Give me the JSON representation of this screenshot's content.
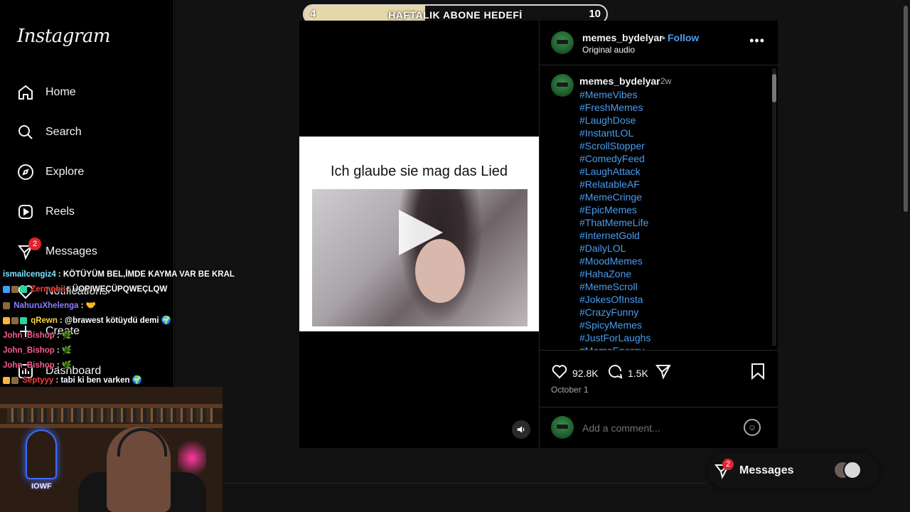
{
  "app": {
    "logo": "Instagram"
  },
  "sidebar": {
    "items": [
      {
        "label": "Home",
        "icon": "home-icon"
      },
      {
        "label": "Search",
        "icon": "search-icon"
      },
      {
        "label": "Explore",
        "icon": "compass-icon"
      },
      {
        "label": "Reels",
        "icon": "reels-icon"
      },
      {
        "label": "Messages",
        "icon": "messages-icon",
        "badge": "2"
      },
      {
        "label": "Notifications",
        "icon": "heart-icon"
      },
      {
        "label": "Create",
        "icon": "plus-icon"
      },
      {
        "label": "Dashboard",
        "icon": "dashboard-icon"
      }
    ]
  },
  "goal": {
    "left": "4",
    "title": "HAFTALIK ABONE HEDEFİ",
    "right": "10",
    "fill_fraction": 0.4,
    "fill_color": "#e5d7aa"
  },
  "post": {
    "media": {
      "caption": "Ich glaube sie mag das Lied"
    },
    "header": {
      "username": "memes_bydelyar",
      "dot": "•",
      "follow": "Follow",
      "audio": "Original audio",
      "more": "•••"
    },
    "caption": {
      "username": "memes_bydelyar",
      "time": "2w",
      "tags": [
        "#MemeVibes",
        "#FreshMemes",
        "#LaughDose",
        "#InstantLOL",
        "#ScrollStopper",
        "#ComedyFeed",
        "#LaughAttack",
        "#RelatableAF",
        "#MemeCringe",
        "#EpicMemes",
        "#ThatMemeLife",
        "#InternetGold",
        "#DailyLOL",
        "#MoodMemes",
        "#HahaZone",
        "#MemeScroll",
        "#JokesOfInsta",
        "#CrazyFunny",
        "#SpicyMemes",
        "#JustForLaughs",
        "#MemeEnergy"
      ]
    },
    "actions": {
      "likes": "92.8K",
      "comments": "1.5K"
    },
    "date": "October 1",
    "comment": {
      "placeholder": "Add a comment..."
    }
  },
  "messages_pill": {
    "label": "Messages",
    "badge": "2"
  },
  "chat": [
    {
      "user": "ismailcengiz4",
      "user_color": "#7fe3ff",
      "text": ": KÖTÜYÜM BEL,İMDE KAYMA VAR BE KRAL"
    },
    {
      "user": "Zermobii",
      "user_color": "#ff3a3a",
      "text": ": ÜOPIWEÇÜPQWEÇLQW"
    },
    {
      "user": "NahuruXhelenga",
      "user_color": "#8a7dff",
      "text": ": 🤝"
    },
    {
      "user": "qRewn",
      "user_color": "#ffd23a",
      "text": ": @brawest kötüydü demi 🌍"
    },
    {
      "user": "John_Bishop",
      "user_color": "#ff5b8a",
      "text": ": 🌿"
    },
    {
      "user": "John_Bishop",
      "user_color": "#ff5b8a",
      "text": ": 🌿"
    },
    {
      "user": "John_Bishop",
      "user_color": "#ff5b8a",
      "text": ": 🌿"
    },
    {
      "user": "Septyyy",
      "user_color": "#ff3a3a",
      "text": ": tabi ki ben varken 🌍"
    }
  ],
  "webcam": {
    "neon_text": "IOWF"
  }
}
